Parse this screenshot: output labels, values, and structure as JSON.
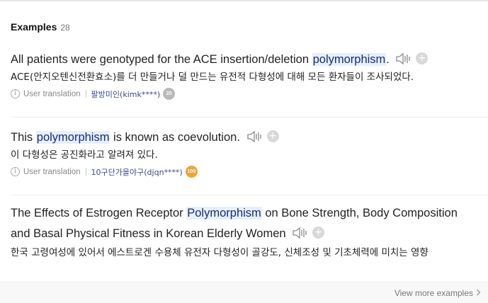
{
  "header": {
    "title": "Examples",
    "count": "28"
  },
  "examples": [
    {
      "en_before": "All patients were genotyped for the ACE insertion/deletion ",
      "en_highlight": "polymorphism",
      "en_after": ".",
      "ko": "ACE(안지오텐신전환효소)를 더 만들거나 덜 만드는 유전적 다형성에 대해 모든 환자들이 조사되었다.",
      "source_label": "User translation",
      "user": "팔방미인(kimk****)",
      "badge": "20",
      "badge_color": "#b9b9b9"
    },
    {
      "en_before": "This ",
      "en_highlight": "polymorphism",
      "en_after": " is known as coevolution.",
      "ko": "이 다형성은 공진화라고 알려져 있다.",
      "source_label": "User translation",
      "user": "10구단가을야구(djqn****)",
      "badge": "100",
      "badge_color": "#f0a23a"
    },
    {
      "en_before": "The Effects of Estrogen Receptor ",
      "en_highlight": "Polymorphism",
      "en_after": " on Bone Strength, Body Composition and Basal Physical Fitness in Korean Elderly Women",
      "ko": "한국 고령여성에 있어서 에스트로겐 수용체 유전자 다형성이 골강도, 신체조성 및 기초체력에 미치는 영향"
    }
  ],
  "footer": {
    "view_more": "View more examples"
  },
  "icons": {
    "speaker": "speaker-icon",
    "add": "add-icon",
    "info": "info-icon",
    "chevron": "chevron-right-icon"
  }
}
